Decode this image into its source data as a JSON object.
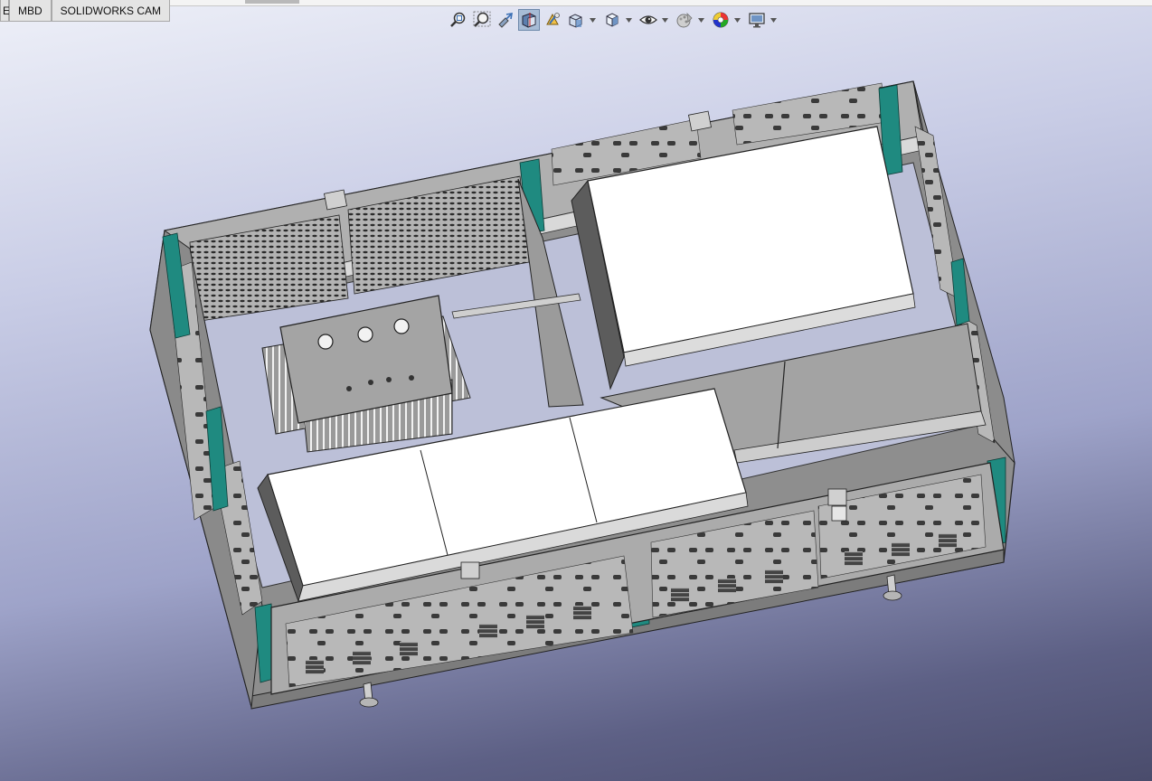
{
  "tabs": [
    {
      "label": "E"
    },
    {
      "label": "MBD"
    },
    {
      "label": "SOLIDWORKS CAM"
    }
  ],
  "heads_up_toolbar": {
    "buttons": [
      {
        "icon": "zoom-to-fit-icon"
      },
      {
        "icon": "zoom-to-area-icon"
      },
      {
        "icon": "previous-view-icon"
      },
      {
        "icon": "section-view-icon",
        "active": true
      },
      {
        "icon": "dynamic-annotation-views-icon"
      },
      {
        "icon": "view-orientation-icon",
        "dropdown": true
      },
      {
        "icon": "display-style-icon",
        "dropdown": true
      },
      {
        "icon": "hide-show-items-icon",
        "dropdown": true
      },
      {
        "icon": "edit-appearance-icon",
        "dropdown": true
      },
      {
        "icon": "apply-scene-icon",
        "dropdown": true
      },
      {
        "icon": "view-settings-icon",
        "dropdown": true
      }
    ]
  },
  "viewport": {
    "background_top": "#eef0f8",
    "background_bottom": "#4a4c6c",
    "model_colors": {
      "sheet_metal": "#a9a9a9",
      "white_blocks": "#ffffff",
      "green_brackets": "#1f8a80",
      "base_plate": "#8e8e8e"
    }
  }
}
